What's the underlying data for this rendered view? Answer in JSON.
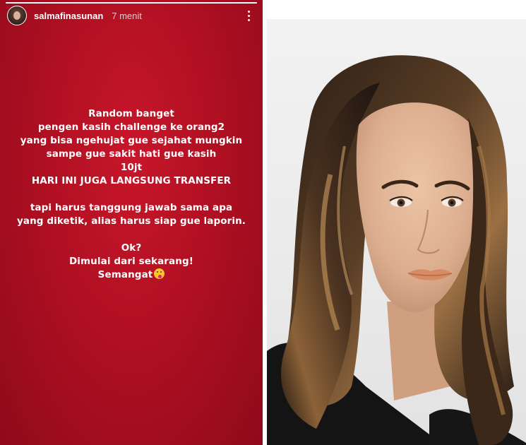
{
  "story": {
    "username": "salmafinasunan",
    "time": "7 menit",
    "progress": 1.0,
    "background_color": "#b01022",
    "lines": [
      "Random banget",
      "pengen kasih challenge ke orang2",
      "yang bisa ngehujat gue sejahat mungkin",
      "sampe gue sakit hati gue kasih",
      "10jt",
      "HARI INI JUGA LANGSUNG TRANSFER",
      "",
      "tapi harus tanggung jawab sama apa",
      "yang diketik, alias harus siap gue laporin.",
      "",
      "Ok?",
      "Dimulai dari sekarang!",
      "Semangat"
    ],
    "closing_emoji": "kissing-face-emoji",
    "icons": {
      "avatar": "profile-avatar",
      "menu": "more-options-icon"
    }
  },
  "photo": {
    "subject": "portrait-photo",
    "colors": {
      "background": "#eeeeee",
      "hair": "#3a2a1e",
      "highlight": "#b8874e",
      "skin": "#e2b79a",
      "lips": "#d88a62",
      "clothing": "#141414"
    }
  }
}
